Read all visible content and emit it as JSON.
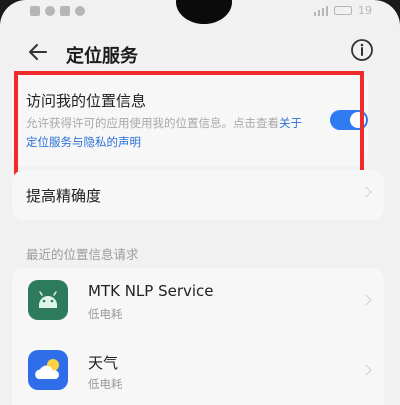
{
  "status_bar": {
    "time": "19"
  },
  "header": {
    "title": "定位服务",
    "back_icon": "back-arrow-icon",
    "info_icon": "info-icon"
  },
  "location_access": {
    "title": "访问我的位置信息",
    "description": "允许获得许可的应用使用我的位置信息。点击查看",
    "link_text": "关于定位服务与隐私的声明",
    "enabled": true
  },
  "accuracy": {
    "label": "提高精确度"
  },
  "recent_requests": {
    "header": "最近的位置信息请求",
    "items": [
      {
        "name": "MTK NLP Service",
        "subtitle": "低电耗",
        "icon": "android-robot-icon"
      },
      {
        "name": "天气",
        "subtitle": "低电耗",
        "icon": "weather-cloud-icon"
      }
    ]
  },
  "colors": {
    "accent": "#2f7bf1",
    "link": "#2a6fd6",
    "highlight_border": "#ef2b2b",
    "android_icon_bg": "#2e7a5e",
    "weather_icon_bg": "#2f6ee8"
  }
}
